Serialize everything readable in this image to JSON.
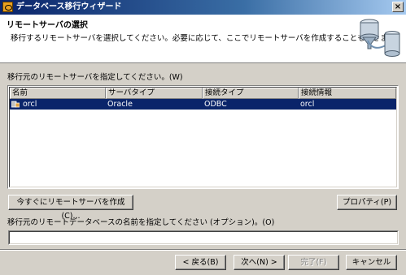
{
  "window": {
    "title": "データベース移行ウィザード",
    "close_label": "×"
  },
  "header": {
    "title": "リモートサーバの選択",
    "description": "移行するリモートサーバを選択してください。必要に応じて、ここでリモートサーバを作成することもできます。",
    "graphic_icon": "database-funnel-icon"
  },
  "server_section": {
    "label": "移行元のリモートサーバを指定してください。(W)",
    "columns": [
      "名前",
      "サーバタイプ",
      "接続タイプ",
      "接続情報"
    ],
    "rows": [
      {
        "name": "orcl",
        "server_type": "Oracle",
        "connection_type": "ODBC",
        "connection_info": "orcl",
        "selected": true,
        "icon": "database-icon"
      }
    ]
  },
  "buttons": {
    "create_server": "今すぐにリモートサーバを作成(C)...",
    "properties": "プロパティ(P)",
    "back": "< 戻る(B)",
    "next": "次へ(N) >",
    "finish": "完了(F)",
    "cancel": "キャンセル"
  },
  "remote_db_section": {
    "label": "移行元のリモートデータベースの名前を指定してください (オプション)。(O)",
    "value": ""
  },
  "colors": {
    "title_bar": "#0a246a",
    "selection": "#0a246a",
    "dialog_bg": "#d4d0c8"
  }
}
